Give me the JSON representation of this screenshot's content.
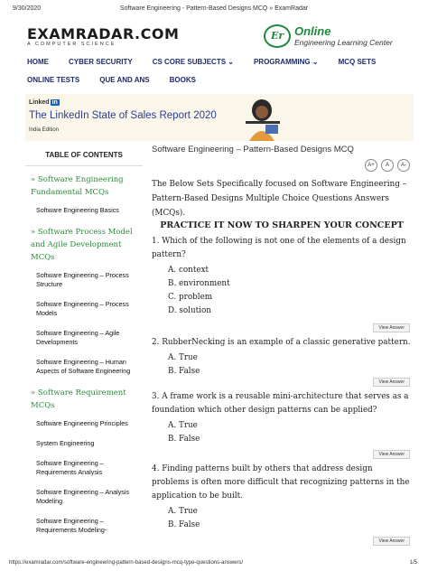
{
  "print": {
    "date": "9/30/2020",
    "title": "Software Engineering - Pattern-Based Designs MCQ » ExamRadar",
    "url": "https://examradar.com/software-engineering-pattern-based-designs-mcq-type-questions-answers/",
    "page": "1/5"
  },
  "logo": {
    "name": "EXAMRADAR.COM",
    "tagline": "A COMPUTER SCIENCE"
  },
  "elc": {
    "emblem": "Er",
    "line1": "Online",
    "line2": "Engineering Learning Center"
  },
  "nav": {
    "row1": [
      "HOME",
      "CYBER SECURITY",
      "CS CORE SUBJECTS ⌄",
      "PROGRAMMING ⌄",
      "MCQ SETS"
    ],
    "row2": [
      "ONLINE TESTS",
      "QUE AND ANS",
      "BOOKS"
    ]
  },
  "ad": {
    "brand": "Linked",
    "brand_badge": "in",
    "headline": "The LinkedIn State of Sales Report 2020",
    "edition": "India Edition"
  },
  "sidebar": {
    "toc_title": "TABLE OF CONTENTS",
    "sections": [
      {
        "title": "» Software Engineering Fundamental MCQs",
        "items": [
          "Software Engineering Basics"
        ]
      },
      {
        "title": "» Software Process Model and Agile Development MCQs",
        "items": [
          "Software Engineering – Process Structure",
          "Software Engineering – Process Models",
          "Software Engineering – Agile Developments",
          "Software Engineering – Human Aspects of Software Engineering"
        ]
      },
      {
        "title": "» Software Requirement MCQs",
        "items": [
          "Software Engineering Principles",
          "System Engineering",
          "Software Engineering – Requirements Analysis",
          "Software Engineering – Analysis Modeling",
          "Software Engineering – Requirements Modeling-"
        ]
      }
    ]
  },
  "main": {
    "title": "Software Engineering – Pattern-Based Designs MCQ",
    "font_buttons": [
      "A+",
      "A",
      "A-"
    ],
    "intro": "The Below Sets Specifically focused on Software Engineering – Pattern-Based Designs Multiple Choice Questions Answers (MCQs).",
    "practice": "PRACTICE IT NOW TO SHARPEN YOUR CONCEPT",
    "view_answer": "View Answer",
    "questions": [
      {
        "text": "1. Which of the following is not one of the elements of a design pattern?",
        "options": [
          "A. context",
          "B. environment",
          "C. problem",
          "D. solution"
        ]
      },
      {
        "text": "2. RubberNecking is an example of a classic generative pattern.",
        "options": [
          "A. True",
          "B. False"
        ]
      },
      {
        "text": "3. A frame work is a reusable mini-architecture that serves as a foundation which other design patterns can be applied?",
        "options": [
          "A. True",
          "B. False"
        ]
      },
      {
        "text": "4. Finding patterns built by others that address design problems is often more difficult that recognizing patterns in the application to be built.",
        "options": [
          "A. True",
          "B. False"
        ]
      }
    ]
  }
}
